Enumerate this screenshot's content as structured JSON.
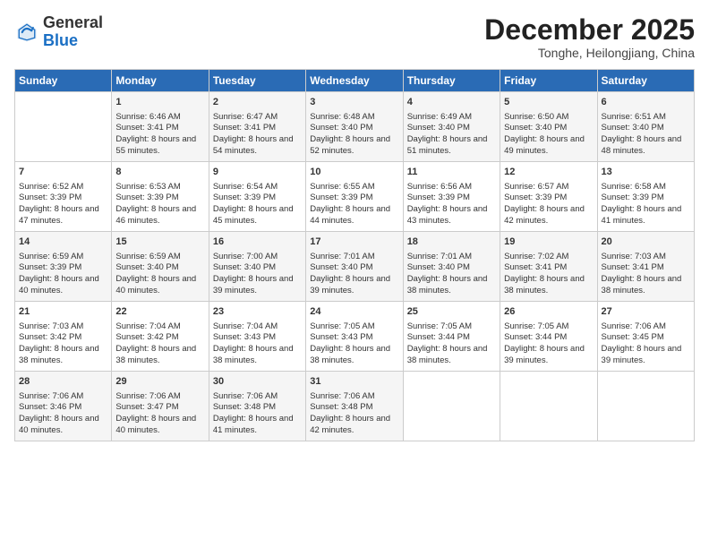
{
  "header": {
    "logo_general": "General",
    "logo_blue": "Blue",
    "month_title": "December 2025",
    "subtitle": "Tonghe, Heilongjiang, China"
  },
  "days_of_week": [
    "Sunday",
    "Monday",
    "Tuesday",
    "Wednesday",
    "Thursday",
    "Friday",
    "Saturday"
  ],
  "weeks": [
    [
      {
        "day": "",
        "sunrise": "",
        "sunset": "",
        "daylight": "",
        "empty": true
      },
      {
        "day": "1",
        "sunrise": "Sunrise: 6:46 AM",
        "sunset": "Sunset: 3:41 PM",
        "daylight": "Daylight: 8 hours and 55 minutes."
      },
      {
        "day": "2",
        "sunrise": "Sunrise: 6:47 AM",
        "sunset": "Sunset: 3:41 PM",
        "daylight": "Daylight: 8 hours and 54 minutes."
      },
      {
        "day": "3",
        "sunrise": "Sunrise: 6:48 AM",
        "sunset": "Sunset: 3:40 PM",
        "daylight": "Daylight: 8 hours and 52 minutes."
      },
      {
        "day": "4",
        "sunrise": "Sunrise: 6:49 AM",
        "sunset": "Sunset: 3:40 PM",
        "daylight": "Daylight: 8 hours and 51 minutes."
      },
      {
        "day": "5",
        "sunrise": "Sunrise: 6:50 AM",
        "sunset": "Sunset: 3:40 PM",
        "daylight": "Daylight: 8 hours and 49 minutes."
      },
      {
        "day": "6",
        "sunrise": "Sunrise: 6:51 AM",
        "sunset": "Sunset: 3:40 PM",
        "daylight": "Daylight: 8 hours and 48 minutes."
      }
    ],
    [
      {
        "day": "7",
        "sunrise": "Sunrise: 6:52 AM",
        "sunset": "Sunset: 3:39 PM",
        "daylight": "Daylight: 8 hours and 47 minutes."
      },
      {
        "day": "8",
        "sunrise": "Sunrise: 6:53 AM",
        "sunset": "Sunset: 3:39 PM",
        "daylight": "Daylight: 8 hours and 46 minutes."
      },
      {
        "day": "9",
        "sunrise": "Sunrise: 6:54 AM",
        "sunset": "Sunset: 3:39 PM",
        "daylight": "Daylight: 8 hours and 45 minutes."
      },
      {
        "day": "10",
        "sunrise": "Sunrise: 6:55 AM",
        "sunset": "Sunset: 3:39 PM",
        "daylight": "Daylight: 8 hours and 44 minutes."
      },
      {
        "day": "11",
        "sunrise": "Sunrise: 6:56 AM",
        "sunset": "Sunset: 3:39 PM",
        "daylight": "Daylight: 8 hours and 43 minutes."
      },
      {
        "day": "12",
        "sunrise": "Sunrise: 6:57 AM",
        "sunset": "Sunset: 3:39 PM",
        "daylight": "Daylight: 8 hours and 42 minutes."
      },
      {
        "day": "13",
        "sunrise": "Sunrise: 6:58 AM",
        "sunset": "Sunset: 3:39 PM",
        "daylight": "Daylight: 8 hours and 41 minutes."
      }
    ],
    [
      {
        "day": "14",
        "sunrise": "Sunrise: 6:59 AM",
        "sunset": "Sunset: 3:39 PM",
        "daylight": "Daylight: 8 hours and 40 minutes."
      },
      {
        "day": "15",
        "sunrise": "Sunrise: 6:59 AM",
        "sunset": "Sunset: 3:40 PM",
        "daylight": "Daylight: 8 hours and 40 minutes."
      },
      {
        "day": "16",
        "sunrise": "Sunrise: 7:00 AM",
        "sunset": "Sunset: 3:40 PM",
        "daylight": "Daylight: 8 hours and 39 minutes."
      },
      {
        "day": "17",
        "sunrise": "Sunrise: 7:01 AM",
        "sunset": "Sunset: 3:40 PM",
        "daylight": "Daylight: 8 hours and 39 minutes."
      },
      {
        "day": "18",
        "sunrise": "Sunrise: 7:01 AM",
        "sunset": "Sunset: 3:40 PM",
        "daylight": "Daylight: 8 hours and 38 minutes."
      },
      {
        "day": "19",
        "sunrise": "Sunrise: 7:02 AM",
        "sunset": "Sunset: 3:41 PM",
        "daylight": "Daylight: 8 hours and 38 minutes."
      },
      {
        "day": "20",
        "sunrise": "Sunrise: 7:03 AM",
        "sunset": "Sunset: 3:41 PM",
        "daylight": "Daylight: 8 hours and 38 minutes."
      }
    ],
    [
      {
        "day": "21",
        "sunrise": "Sunrise: 7:03 AM",
        "sunset": "Sunset: 3:42 PM",
        "daylight": "Daylight: 8 hours and 38 minutes."
      },
      {
        "day": "22",
        "sunrise": "Sunrise: 7:04 AM",
        "sunset": "Sunset: 3:42 PM",
        "daylight": "Daylight: 8 hours and 38 minutes."
      },
      {
        "day": "23",
        "sunrise": "Sunrise: 7:04 AM",
        "sunset": "Sunset: 3:43 PM",
        "daylight": "Daylight: 8 hours and 38 minutes."
      },
      {
        "day": "24",
        "sunrise": "Sunrise: 7:05 AM",
        "sunset": "Sunset: 3:43 PM",
        "daylight": "Daylight: 8 hours and 38 minutes."
      },
      {
        "day": "25",
        "sunrise": "Sunrise: 7:05 AM",
        "sunset": "Sunset: 3:44 PM",
        "daylight": "Daylight: 8 hours and 38 minutes."
      },
      {
        "day": "26",
        "sunrise": "Sunrise: 7:05 AM",
        "sunset": "Sunset: 3:44 PM",
        "daylight": "Daylight: 8 hours and 39 minutes."
      },
      {
        "day": "27",
        "sunrise": "Sunrise: 7:06 AM",
        "sunset": "Sunset: 3:45 PM",
        "daylight": "Daylight: 8 hours and 39 minutes."
      }
    ],
    [
      {
        "day": "28",
        "sunrise": "Sunrise: 7:06 AM",
        "sunset": "Sunset: 3:46 PM",
        "daylight": "Daylight: 8 hours and 40 minutes."
      },
      {
        "day": "29",
        "sunrise": "Sunrise: 7:06 AM",
        "sunset": "Sunset: 3:47 PM",
        "daylight": "Daylight: 8 hours and 40 minutes."
      },
      {
        "day": "30",
        "sunrise": "Sunrise: 7:06 AM",
        "sunset": "Sunset: 3:48 PM",
        "daylight": "Daylight: 8 hours and 41 minutes."
      },
      {
        "day": "31",
        "sunrise": "Sunrise: 7:06 AM",
        "sunset": "Sunset: 3:48 PM",
        "daylight": "Daylight: 8 hours and 42 minutes."
      },
      {
        "day": "",
        "sunrise": "",
        "sunset": "",
        "daylight": "",
        "empty": true
      },
      {
        "day": "",
        "sunrise": "",
        "sunset": "",
        "daylight": "",
        "empty": true
      },
      {
        "day": "",
        "sunrise": "",
        "sunset": "",
        "daylight": "",
        "empty": true
      }
    ]
  ]
}
